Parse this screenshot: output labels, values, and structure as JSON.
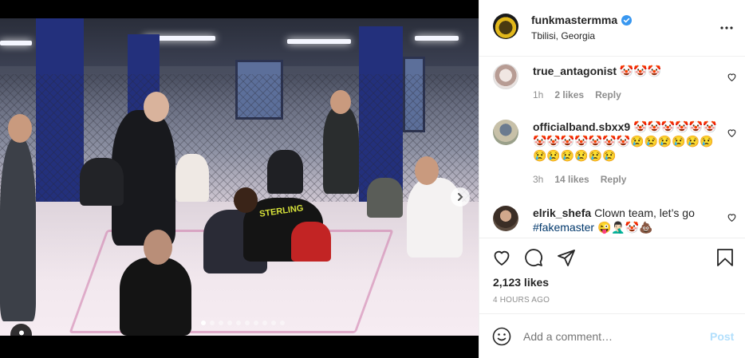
{
  "post": {
    "author": "funkmastermma",
    "location": "Tbilisi, Georgia",
    "likes": "2,123 likes",
    "time_ago": "4 HOURS AGO",
    "carousel": {
      "count": 10,
      "active_index": 0
    }
  },
  "photo_text": {
    "shirt_print": "STERLING"
  },
  "comments": [
    {
      "username": "true_antagonist",
      "text": "🤡🤡🤡",
      "time": "1h",
      "likes": "2 likes",
      "reply": "Reply"
    },
    {
      "username": "officialband.sbxx9",
      "text": "🤡🤡🤡🤡🤡🤡🤡🤡🤡🤡🤡🤡🤡😢😢😢😢😢😢😢😢😢😢😢😢",
      "time": "3h",
      "likes": "14 likes",
      "reply": "Reply"
    },
    {
      "username": "elrik_shefa",
      "text": "Clown team, let’s go",
      "hashtag": "#fakemaster",
      "emojis": "😜🤦🏻‍♂️🤡💩"
    }
  ],
  "composer": {
    "placeholder": "Add a comment…",
    "post_label": "Post"
  },
  "icons": {
    "verified": "verified-badge-icon",
    "more": "more-options-icon",
    "like": "heart-icon",
    "comment": "comment-icon",
    "share": "share-icon",
    "save": "bookmark-icon",
    "emoji": "emoji-icon",
    "next": "chevron-right-icon",
    "tag": "user-tag-icon"
  },
  "colors": {
    "verified": "#3897f0",
    "post_disabled": "#b2dffc",
    "hashtag": "#00376b",
    "muted": "#8e8e8e"
  }
}
